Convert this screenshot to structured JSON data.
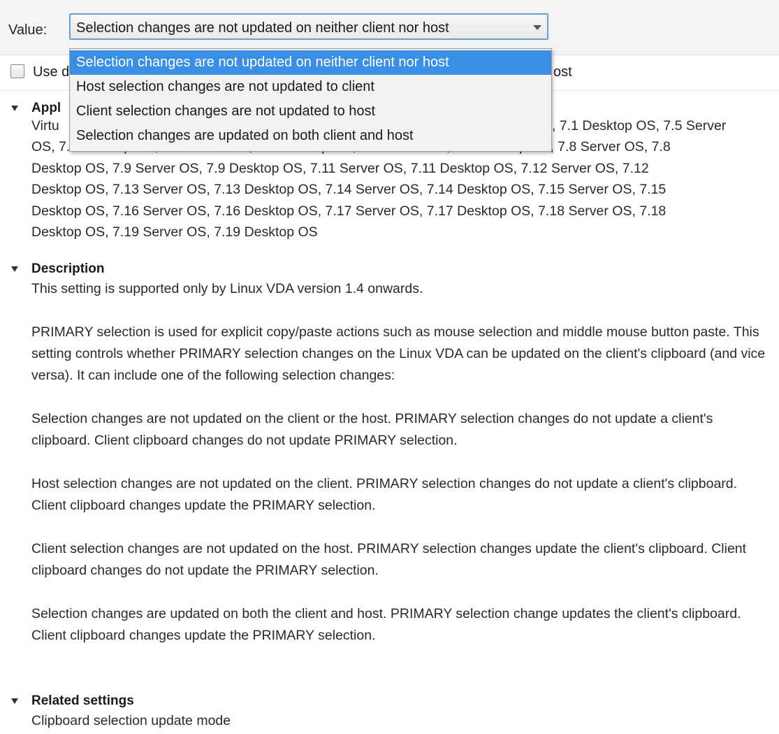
{
  "value_bar": {
    "label": "Value:",
    "selected": "Selection changes are not updated on neither client nor host"
  },
  "dropdown": {
    "options": [
      "Selection changes are not updated on neither client nor host",
      "Host selection changes are not updated to client",
      "Client selection changes are not updated to host",
      "Selection changes are updated on both client and host"
    ],
    "selected_index": 0
  },
  "checkbox": {
    "label_visible_left": "Use d",
    "label_visible_right": "ost",
    "checked": false
  },
  "applies_to": {
    "title": "Appl",
    "line1_left": "Virtu",
    "line1_right": "S, 7.1 Desktop OS, 7.5 Server",
    "line2": "OS, 7.5 Desktop OS, 7.6 Server OS, 7.6 Desktop OS, 7.7 Server OS, 7.7 Desktop OS, 7.8 Server OS, 7.8",
    "line3": "Desktop OS, 7.9 Server OS, 7.9 Desktop OS, 7.11 Server OS, 7.11 Desktop OS, 7.12 Server OS, 7.12",
    "line4": "Desktop OS, 7.13 Server OS, 7.13 Desktop OS, 7.14 Server OS, 7.14 Desktop OS, 7.15 Server OS, 7.15",
    "line5": "Desktop OS, 7.16 Server OS, 7.16 Desktop OS, 7.17 Server OS, 7.17 Desktop OS, 7.18 Server OS, 7.18",
    "line6": "Desktop OS, 7.19 Server OS, 7.19 Desktop OS"
  },
  "description": {
    "title": "Description",
    "paragraphs": [
      "This setting is supported only by Linux VDA version 1.4 onwards.",
      "PRIMARY selection is used for explicit copy/paste actions such as mouse selection and middle mouse button paste. This setting controls whether PRIMARY selection changes on the Linux VDA can be updated on the client's clipboard (and vice versa). It can include one of the following selection changes:",
      "Selection changes are not updated on the client or the host. PRIMARY selection changes do not update a client's clipboard. Client clipboard changes do not update PRIMARY selection.",
      "Host selection changes are not updated on the client. PRIMARY selection changes do not update a client's clipboard. Client clipboard changes update the PRIMARY selection.",
      "Client selection changes are not updated on the host. PRIMARY selection changes update the client's clipboard. Client clipboard changes do not update the PRIMARY selection.",
      "Selection changes are updated on both the client and host. PRIMARY selection change updates the client's clipboard. Client clipboard changes update the PRIMARY selection."
    ]
  },
  "related_settings": {
    "title": "Related settings",
    "items": [
      "Clipboard selection update mode"
    ]
  }
}
